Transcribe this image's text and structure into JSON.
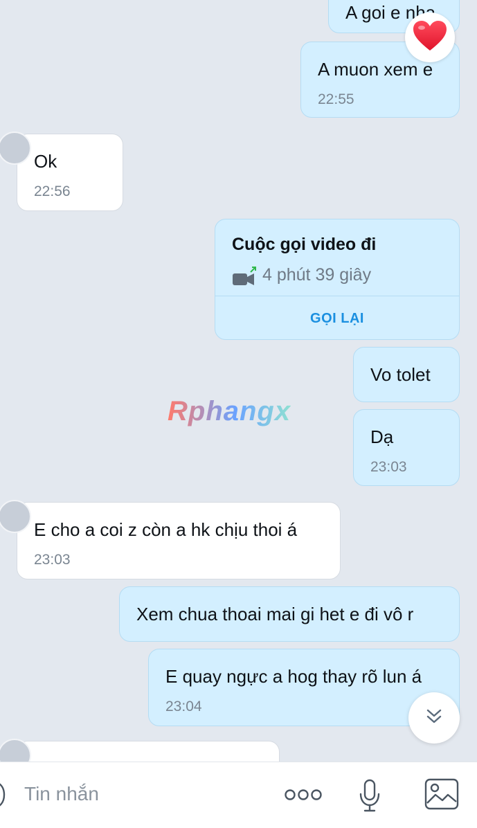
{
  "messages": [
    {
      "text": "A goi e nha"
    },
    {
      "text": "A muon xem e",
      "time": "22:55",
      "reaction": "heart"
    },
    {
      "text": "Ok",
      "time": "22:56"
    },
    {
      "call": {
        "title": "Cuộc gọi video đi",
        "duration": "4 phút 39 giây",
        "action": "GỌI LẠI"
      }
    },
    {
      "text": "Vo tolet"
    },
    {
      "text": "Dạ",
      "time": "23:03"
    },
    {
      "text": "E cho a coi z còn a hk chịu thoi á",
      "time": "23:03"
    },
    {
      "text": "Xem chua thoai mai gi het e đi vô r"
    },
    {
      "text": "E quay ngực a hog thay rõ lun á",
      "time": "23:04"
    }
  ],
  "watermark": "Rphangx",
  "input": {
    "placeholder": "Tin nhắn"
  },
  "icons": [
    "heart-icon",
    "video-call-icon",
    "chevron-double-down-icon",
    "more-icon",
    "microphone-icon",
    "image-icon"
  ],
  "colors": {
    "sent_bubble": "#d3efff",
    "recv_bubble": "#ffffff",
    "accent": "#1a8fe0",
    "background": "#e3e8ef"
  }
}
